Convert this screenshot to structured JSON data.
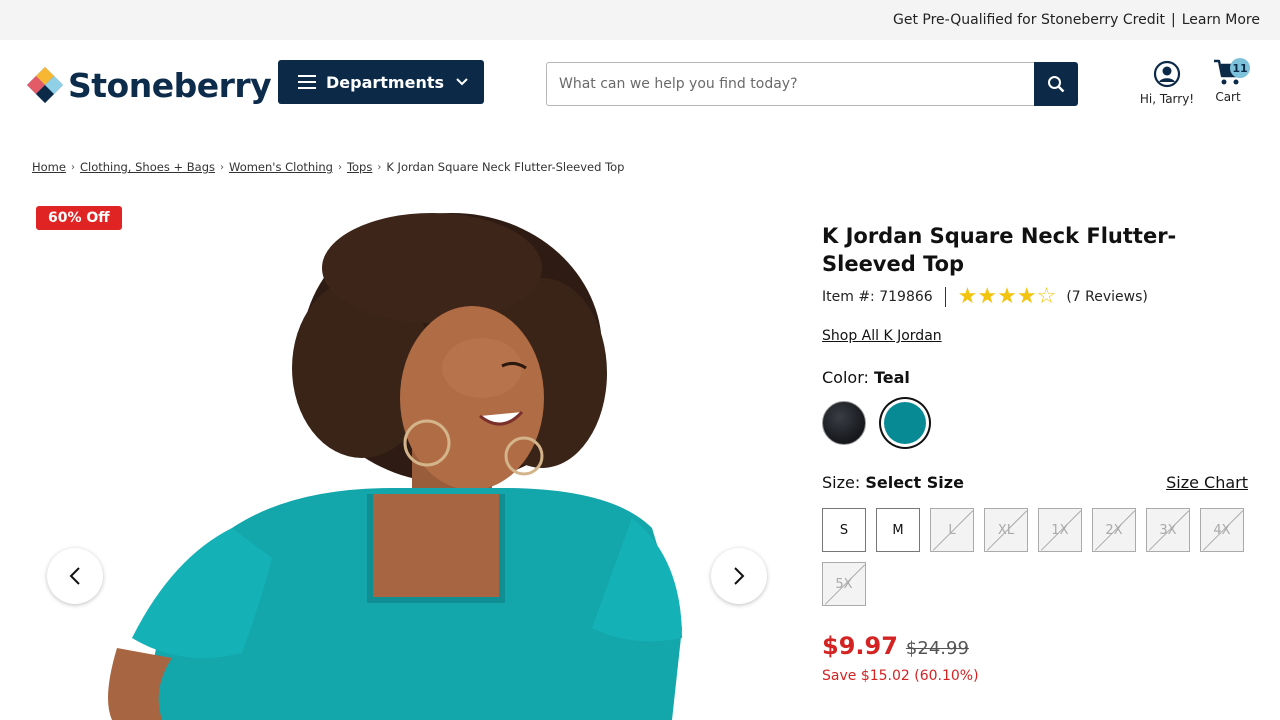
{
  "promo": {
    "text": "Get Pre-Qualified for Stoneberry Credit",
    "separator": "|",
    "link": "Learn More"
  },
  "header": {
    "logo_text": "Stoneberry",
    "departments_label": "Departments",
    "search_placeholder": "What can we help you find today?",
    "account_label": "Hi, Tarry!",
    "cart_label": "Cart",
    "cart_count": "11"
  },
  "breadcrumb": {
    "items": [
      "Home",
      "Clothing, Shoes + Bags",
      "Women's Clothing",
      "Tops"
    ],
    "current": "K Jordan Square Neck Flutter-Sleeved Top"
  },
  "gallery": {
    "discount_badge": "60% Off"
  },
  "product": {
    "title": "K Jordan Square Neck Flutter-Sleeved Top",
    "item_number": "Item #: 719866",
    "rating": 4,
    "rating_max": 5,
    "reviews": "(7 Reviews)",
    "shop_all": "Shop All K Jordan",
    "color_label": "Color:",
    "color_value": "Teal",
    "colors": [
      {
        "name": "Black",
        "hex": "#1b1d21"
      },
      {
        "name": "Teal",
        "hex": "#078a94"
      }
    ],
    "size_label": "Size:",
    "size_value": "Select Size",
    "size_chart": "Size Chart",
    "sizes": [
      {
        "label": "S",
        "available": true
      },
      {
        "label": "M",
        "available": true
      },
      {
        "label": "L",
        "available": false
      },
      {
        "label": "XL",
        "available": false
      },
      {
        "label": "1X",
        "available": false
      },
      {
        "label": "2X",
        "available": false
      },
      {
        "label": "3X",
        "available": false
      },
      {
        "label": "4X",
        "available": false
      },
      {
        "label": "5X",
        "available": false
      }
    ],
    "price": "$9.97",
    "original_price": "$24.99",
    "savings": "Save $15.02 (60.10%)"
  },
  "colors": {
    "navy": "#0c2a48",
    "sale_red": "#d32323",
    "badge_red": "#e02424",
    "star_gold": "#f2c40f"
  }
}
